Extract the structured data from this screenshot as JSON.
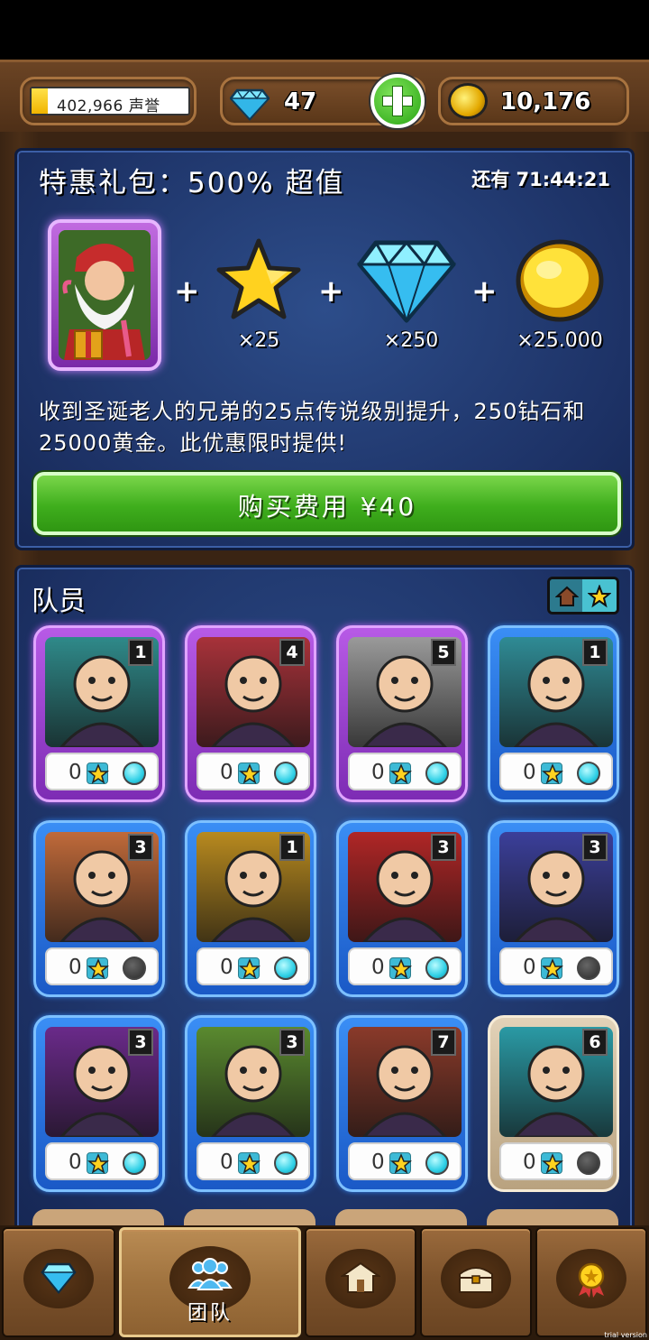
{
  "header": {
    "reputation": "402,966 声誉",
    "gems": "47",
    "gold": "10,176"
  },
  "offer": {
    "title": "特惠礼包：500% 超值",
    "timer": "还有 71:44:21",
    "rewards": [
      {
        "qty": "×25",
        "icon": "star-icon"
      },
      {
        "qty": "×250",
        "icon": "diamond-icon"
      },
      {
        "qty": "×25.000",
        "icon": "gold-coin-icon"
      }
    ],
    "description": "收到圣诞老人的兄弟的25点传说级别提升，250钻石和25000黄金。此优惠限时提供!",
    "buy_label": "购买费用 ¥40"
  },
  "team": {
    "title": "队员",
    "cards": [
      {
        "level": "1",
        "count": "0",
        "rarity": "purple",
        "active": true,
        "color": "#2f8a8a"
      },
      {
        "level": "4",
        "count": "0",
        "rarity": "purple",
        "active": true,
        "color": "#a8323a"
      },
      {
        "level": "5",
        "count": "0",
        "rarity": "purple",
        "active": true,
        "color": "#9a9a9a"
      },
      {
        "level": "1",
        "count": "0",
        "rarity": "blue",
        "active": true,
        "color": "#2f8b95"
      },
      {
        "level": "3",
        "count": "0",
        "rarity": "blue",
        "active": false,
        "color": "#c06a3a"
      },
      {
        "level": "1",
        "count": "0",
        "rarity": "blue",
        "active": true,
        "color": "#b88a1f"
      },
      {
        "level": "3",
        "count": "0",
        "rarity": "blue",
        "active": true,
        "color": "#b02626"
      },
      {
        "level": "3",
        "count": "0",
        "rarity": "blue",
        "active": false,
        "color": "#3b3f9a"
      },
      {
        "level": "3",
        "count": "0",
        "rarity": "blue",
        "active": true,
        "color": "#6a2a8a"
      },
      {
        "level": "3",
        "count": "0",
        "rarity": "blue",
        "active": true,
        "color": "#5a8a2f"
      },
      {
        "level": "7",
        "count": "0",
        "rarity": "blue",
        "active": true,
        "color": "#8a3a2a"
      },
      {
        "level": "6",
        "count": "0",
        "rarity": "tan",
        "active": false,
        "color": "#2a9aa5"
      }
    ]
  },
  "nav": {
    "tabs": [
      {
        "name": "shop",
        "label": "",
        "icon": "diamond-icon"
      },
      {
        "name": "team",
        "label": "团队",
        "icon": "team-icon"
      },
      {
        "name": "buildings",
        "label": "",
        "icon": "buildings-icon"
      },
      {
        "name": "chest",
        "label": "",
        "icon": "treasure-chest-icon"
      },
      {
        "name": "achievements",
        "label": "",
        "icon": "medal-icon"
      }
    ],
    "watermark": "trial version"
  }
}
